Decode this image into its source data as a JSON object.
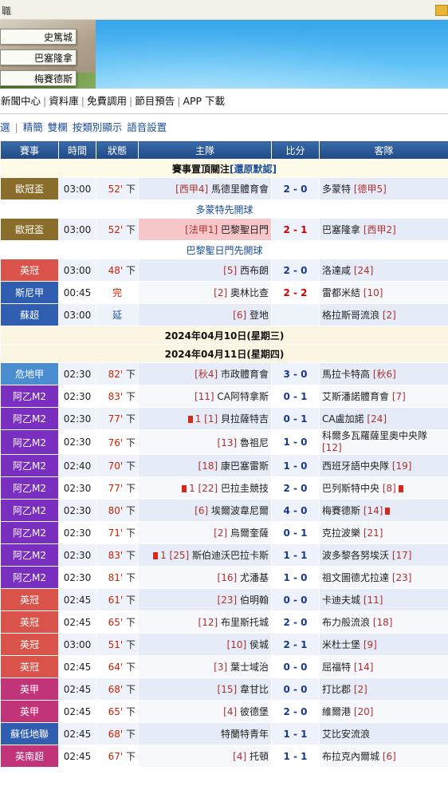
{
  "window": {
    "title": "職"
  },
  "banner": {
    "pills": [
      "史篤城",
      "巴塞隆拿",
      "梅賽德斯"
    ]
  },
  "nav": [
    "新聞中心",
    "資料庫",
    "免費調用",
    "節目預告",
    "APP 下載"
  ],
  "subnav": [
    "選",
    "精簡",
    "雙欄",
    "按類別顯示",
    "語音設置"
  ],
  "table": {
    "headers": [
      "賽事",
      "時間",
      "狀態",
      "主隊",
      "比分",
      "客隊"
    ],
    "pinned_label": "賽事置頂關注",
    "pinned_link": "還原默認",
    "date1": "2024年04月10日(星期三)",
    "date2": "2024年04月11日(星期四)",
    "pinned": [
      {
        "league": "歐冠盃",
        "color": "#8a6d2a",
        "time": "03:00",
        "status": "52'",
        "status_suffix": "下",
        "home_rank": "[西甲4]",
        "home": "馬德里體育會",
        "score": "2 - 0",
        "away": "多蒙特",
        "away_rank": "[德甲5]",
        "note": "多蒙特先開球"
      },
      {
        "league": "歐冠盃",
        "color": "#8a6d2a",
        "time": "03:00",
        "status": "52'",
        "status_suffix": "下",
        "home_rank": "[法甲1]",
        "home": "巴黎聖日門",
        "score": "2 - 1",
        "away": "巴塞隆拿",
        "away_rank": "[西甲2]",
        "note": "巴黎聖日門先開球"
      }
    ],
    "rows_before": [
      {
        "league": "英冠",
        "color": "#d9534a",
        "time": "03:00",
        "status": "48'",
        "status_suffix": "下",
        "home_rank": "[5]",
        "home": "西布朗",
        "score": "2 - 0",
        "away": "洛達咸",
        "away_rank": "[24]"
      },
      {
        "league": "斯尼甲",
        "color": "#2f5db0",
        "time": "00:45",
        "status": "完",
        "status_suffix": "",
        "home_rank": "[2]",
        "home": "奧林比查",
        "score": "2 - 2",
        "away": "雷都米結",
        "away_rank": "[10]"
      },
      {
        "league": "蘇超",
        "color": "#2f5db0",
        "time": "03:00",
        "status": "延",
        "status_suffix": "",
        "home_rank": "[6]",
        "home": "登地",
        "score": "",
        "away": "格拉斯哥流浪",
        "away_rank": "[2]"
      }
    ],
    "rows": [
      {
        "league": "危地甲",
        "color": "#4a8ed1",
        "time": "02:30",
        "status": "82'",
        "status_suffix": "下",
        "home_rank": "[秋4]",
        "home": "市政體育會",
        "score": "3 - 0",
        "away": "馬拉卡特高",
        "away_rank": "[秋6]"
      },
      {
        "league": "阿乙M2",
        "color": "#7a2fc0",
        "time": "02:30",
        "status": "83'",
        "status_suffix": "下",
        "home_rank": "[11]",
        "home": "CA阿特拿斯",
        "score": "0 - 1",
        "away": "艾斯潘諾體育會",
        "away_rank": "[7]"
      },
      {
        "league": "阿乙M2",
        "color": "#7a2fc0",
        "time": "02:30",
        "status": "77'",
        "status_suffix": "下",
        "home_card": "1",
        "home_rank": "[1]",
        "home": "貝拉薩特吉",
        "score": "0 - 1",
        "away": "CA盧加諾",
        "away_rank": "[24]"
      },
      {
        "league": "阿乙M2",
        "color": "#7a2fc0",
        "time": "02:30",
        "status": "76'",
        "status_suffix": "下",
        "home_rank": "[13]",
        "home": "魯祖尼",
        "score": "1 - 0",
        "away": "科爾多瓦羅薩里奧中央隊",
        "away_rank": "[12]",
        "tall": true
      },
      {
        "league": "阿乙M2",
        "color": "#7a2fc0",
        "time": "02:40",
        "status": "70'",
        "status_suffix": "下",
        "home_rank": "[18]",
        "home": "康巴塞雷斯",
        "score": "1 - 0",
        "away": "西班牙語中央隊",
        "away_rank": "[19]"
      },
      {
        "league": "阿乙M2",
        "color": "#7a2fc0",
        "time": "02:30",
        "status": "77'",
        "status_suffix": "下",
        "home_card": "1",
        "home_rank": "[22]",
        "home": "巴拉圭競技",
        "score": "2 - 0",
        "away": "巴列斯特中央",
        "away_rank": "[8]",
        "away_card": "1"
      },
      {
        "league": "阿乙M2",
        "color": "#7a2fc0",
        "time": "02:30",
        "status": "80'",
        "status_suffix": "下",
        "home_rank": "[6]",
        "home": "埃爾波韋尼爾",
        "score": "4 - 0",
        "away": "梅賽德斯",
        "away_rank": "[14]",
        "away_card": "1"
      },
      {
        "league": "阿乙M2",
        "color": "#7a2fc0",
        "time": "02:30",
        "status": "71'",
        "status_suffix": "下",
        "home_rank": "[2]",
        "home": "烏爾奎薩",
        "score": "0 - 1",
        "away": "克拉波樂",
        "away_rank": "[21]"
      },
      {
        "league": "阿乙M2",
        "color": "#7a2fc0",
        "time": "02:30",
        "status": "83'",
        "status_suffix": "下",
        "home_card": "1",
        "home_rank": "[25]",
        "home": "斯伯迪沃巴拉卡斯",
        "score": "1 - 1",
        "away": "波多黎各努埃沃",
        "away_rank": "[17]"
      },
      {
        "league": "阿乙M2",
        "color": "#7a2fc0",
        "time": "02:30",
        "status": "81'",
        "status_suffix": "下",
        "home_rank": "[16]",
        "home": "尤潘基",
        "score": "1 - 0",
        "away": "祖文圖德尤拉達",
        "away_rank": "[23]"
      },
      {
        "league": "英冠",
        "color": "#d9534a",
        "time": "02:45",
        "status": "61'",
        "status_suffix": "下",
        "home_rank": "[23]",
        "home": "伯明翰",
        "score": "0 - 0",
        "away": "卡迪夫城",
        "away_rank": "[11]"
      },
      {
        "league": "英冠",
        "color": "#d9534a",
        "time": "02:45",
        "status": "65'",
        "status_suffix": "下",
        "home_rank": "[12]",
        "home": "布里斯托城",
        "score": "2 - 0",
        "away": "布力般流浪",
        "away_rank": "[18]"
      },
      {
        "league": "英冠",
        "color": "#d9534a",
        "time": "03:00",
        "status": "51'",
        "status_suffix": "下",
        "home_rank": "[10]",
        "home": "侯城",
        "score": "2 - 1",
        "away": "米杜士堡",
        "away_rank": "[9]"
      },
      {
        "league": "英冠",
        "color": "#d9534a",
        "time": "02:45",
        "status": "64'",
        "status_suffix": "下",
        "home_rank": "[3]",
        "home": "葉士域治",
        "score": "0 - 0",
        "away": "屈福特",
        "away_rank": "[14]"
      },
      {
        "league": "英甲",
        "color": "#c2347a",
        "time": "02:45",
        "status": "68'",
        "status_suffix": "下",
        "home_rank": "[15]",
        "home": "韋甘比",
        "score": "0 - 0",
        "away": "打比郡",
        "away_rank": "[2]"
      },
      {
        "league": "英甲",
        "color": "#c2347a",
        "time": "02:45",
        "status": "65'",
        "status_suffix": "下",
        "home_rank": "[4]",
        "home": "彼德堡",
        "score": "2 - 0",
        "away": "維爾港",
        "away_rank": "[20]"
      },
      {
        "league": "蘇低地聯",
        "color": "#2f5db0",
        "time": "02:45",
        "status": "68'",
        "status_suffix": "下",
        "home_rank": "",
        "home": "特蘭特青年",
        "score": "1 - 1",
        "away": "艾比安流浪",
        "away_rank": ""
      },
      {
        "league": "英南超",
        "color": "#c2347a",
        "time": "02:45",
        "status": "67'",
        "status_suffix": "下",
        "home_rank": "[4]",
        "home": "托頓",
        "score": "1 - 1",
        "away": "布拉克內爾城",
        "away_rank": "[6]"
      }
    ]
  }
}
